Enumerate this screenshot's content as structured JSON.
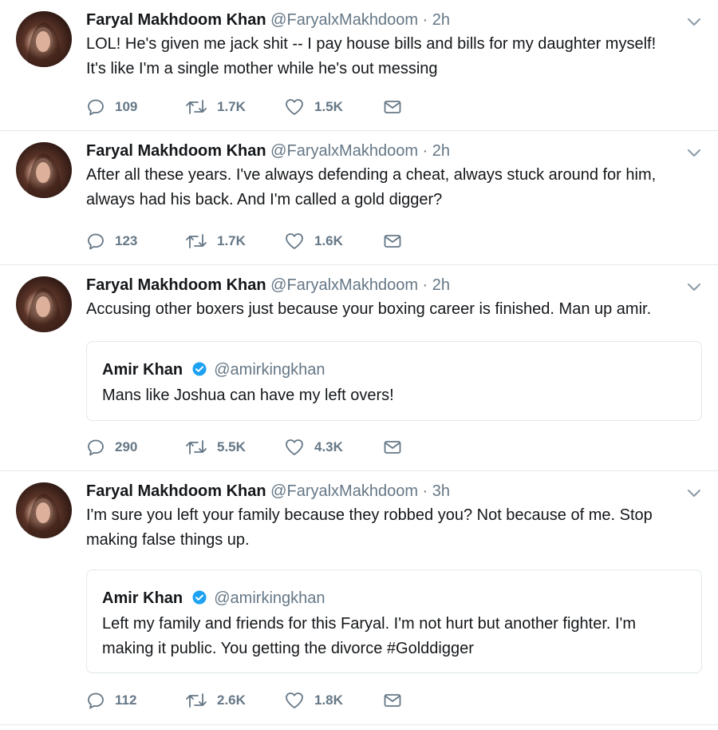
{
  "tweets": [
    {
      "name": "Faryal Makhdoom Khan",
      "handle": "@FaryalxMakhdoom",
      "separator": "·",
      "time": "2h",
      "text_lines": [
        "LOL! He's given me jack shit -- I pay house bills and bills for my daughter myself!",
        "It's like I'm a single mother while he's out messing"
      ],
      "replies": "109",
      "retweets": "1.7K",
      "likes": "1.5K"
    },
    {
      "name": "Faryal Makhdoom Khan",
      "handle": "@FaryalxMakhdoom",
      "separator": "·",
      "time": "2h",
      "text_lines": [
        "After all these years. I've always defending a cheat, always stuck around for him,",
        "always had his back. And I'm called a gold digger?"
      ],
      "replies": "123",
      "retweets": "1.7K",
      "likes": "1.6K"
    },
    {
      "name": "Faryal Makhdoom Khan",
      "handle": "@FaryalxMakhdoom",
      "separator": "·",
      "time": "2h",
      "text_lines": [
        "Accusing other boxers just because your boxing career is finished. Man up amir."
      ],
      "quote": {
        "name": "Amir Khan",
        "handle": "@amirkingkhan",
        "text_lines": [
          "Mans like Joshua can have my left overs!"
        ]
      },
      "replies": "290",
      "retweets": "5.5K",
      "likes": "4.3K"
    },
    {
      "name": "Faryal Makhdoom Khan",
      "handle": "@FaryalxMakhdoom",
      "separator": "·",
      "time": "3h",
      "text_lines": [
        "I'm sure you left your family because they robbed you? Not because of me. Stop",
        "making false things up."
      ],
      "quote": {
        "name": "Amir Khan",
        "handle": "@amirkingkhan",
        "text_lines": [
          "Left my family and friends for this Faryal. I'm not hurt but another fighter. I'm",
          "making it public. You getting the divorce #Golddigger"
        ]
      },
      "replies": "112",
      "retweets": "2.6K",
      "likes": "1.8K"
    }
  ],
  "icons": {
    "reply": "reply-icon",
    "retweet": "retweet-icon",
    "like": "heart-icon",
    "dm": "envelope-icon",
    "caret": "chevron-down-icon",
    "verified": "verified-badge-icon"
  },
  "colors": {
    "text": "#14171a",
    "secondary": "#657786",
    "border": "#e1e8ed",
    "verified": "#1da1f2"
  }
}
